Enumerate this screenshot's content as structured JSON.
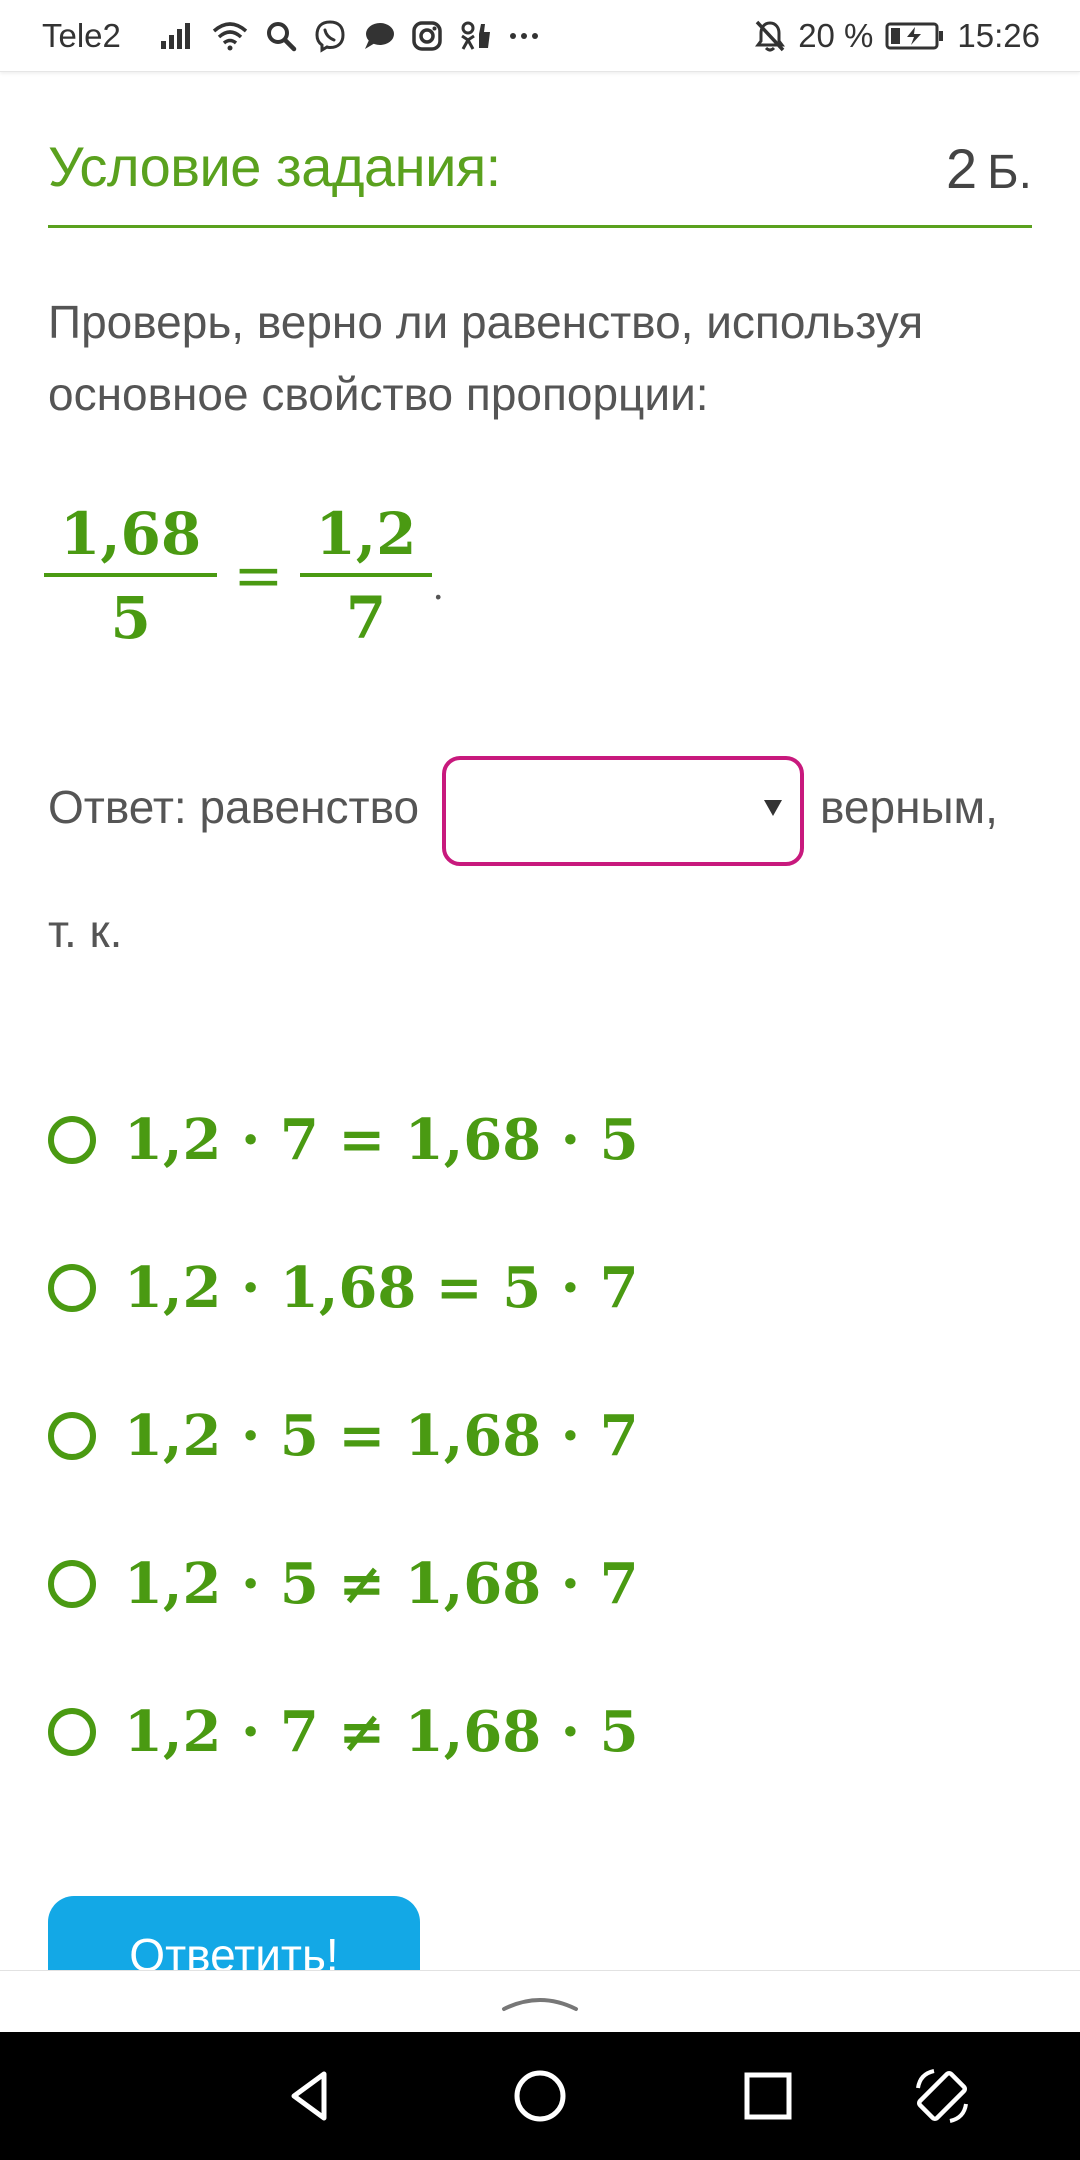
{
  "status_bar": {
    "carrier": "Tele2",
    "battery_percent": "20 %",
    "time": "15:26",
    "icons_left": [
      "signal-icon",
      "wifi-icon",
      "search-icon",
      "viber-icon",
      "chat-icon",
      "instagram-icon",
      "ok-icon",
      "more-icon"
    ],
    "icons_right": [
      "bell-muted-icon",
      "battery-charging-icon"
    ]
  },
  "header": {
    "title": "Условие задания:",
    "points_value": "2",
    "points_unit": "Б."
  },
  "instruction": "Проверь, верно ли равенство, используя основное свойство пропорции:",
  "equation": {
    "left_numerator": "1,68",
    "left_denominator": "5",
    "sign": "=",
    "right_numerator": "1,2",
    "right_denominator": "7",
    "end": "."
  },
  "answer": {
    "prefix": "Ответ: равенство",
    "select_value": "",
    "suffix": "верным,",
    "because": "т. к."
  },
  "options": [
    {
      "label": "1,2 · 7 = 1,68 · 5",
      "selected": false
    },
    {
      "label": "1,2 · 1,68 = 5 · 7",
      "selected": false
    },
    {
      "label": "1,2 · 5 = 1,68 · 7",
      "selected": false
    },
    {
      "label": "1,2 · 5 ≠ 1,68 · 7",
      "selected": false
    },
    {
      "label": "1,2 · 7 ≠ 1,68 · 5",
      "selected": false
    }
  ],
  "submit_label": "Ответить!",
  "colors": {
    "accent_green": "#5aa11e",
    "math_green": "#4a9a12",
    "select_border": "#c8197d",
    "button_blue": "#13a8e6"
  }
}
